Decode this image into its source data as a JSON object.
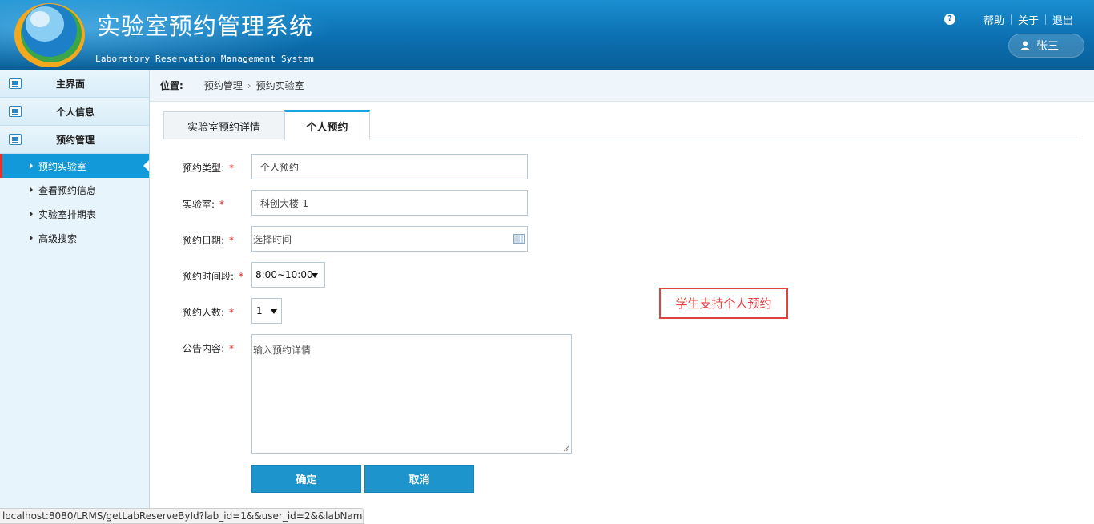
{
  "header": {
    "title": "实验室预约管理系统",
    "subtitle": "Laboratory Reservation Management System",
    "help_icon": "?",
    "nav": [
      "帮助",
      "关于",
      "退出"
    ],
    "user_name": "张三"
  },
  "sidebar": {
    "sections": [
      {
        "label": "主界面"
      },
      {
        "label": "个人信息"
      },
      {
        "label": "预约管理"
      }
    ],
    "items": [
      {
        "label": "预约实验室",
        "active": true
      },
      {
        "label": "查看预约信息"
      },
      {
        "label": "实验室排期表"
      },
      {
        "label": "高级搜索"
      }
    ]
  },
  "breadcrumb": {
    "label": "位置:",
    "path": [
      "预约管理",
      "预约实验室"
    ],
    "separator": "›"
  },
  "tabs": [
    {
      "label": "实验室预约详情"
    },
    {
      "label": "个人预约",
      "active": true
    }
  ],
  "form": {
    "required_mark": "*",
    "type": {
      "label": "预约类型:",
      "value": "个人预约"
    },
    "lab": {
      "label": "实验室:",
      "value": "科创大楼-1"
    },
    "date": {
      "label": "预约日期:",
      "placeholder": "选择时间"
    },
    "slot": {
      "label": "预约时间段:",
      "value": "8:00~10:00"
    },
    "count": {
      "label": "预约人数:",
      "value": "1"
    },
    "content": {
      "label": "公告内容:",
      "placeholder": "输入预约详情"
    }
  },
  "buttons": {
    "confirm": "确定",
    "cancel": "取消"
  },
  "annotation": "学生支持个人预约",
  "status_url": "localhost:8080/LRMS/getLabReserveById?lab_id=1&&user_id=2&&labNam...",
  "colors": {
    "header": "#0b6fb0",
    "active": "#1199d9",
    "accent": "#e14040",
    "button": "#1d94cc"
  }
}
